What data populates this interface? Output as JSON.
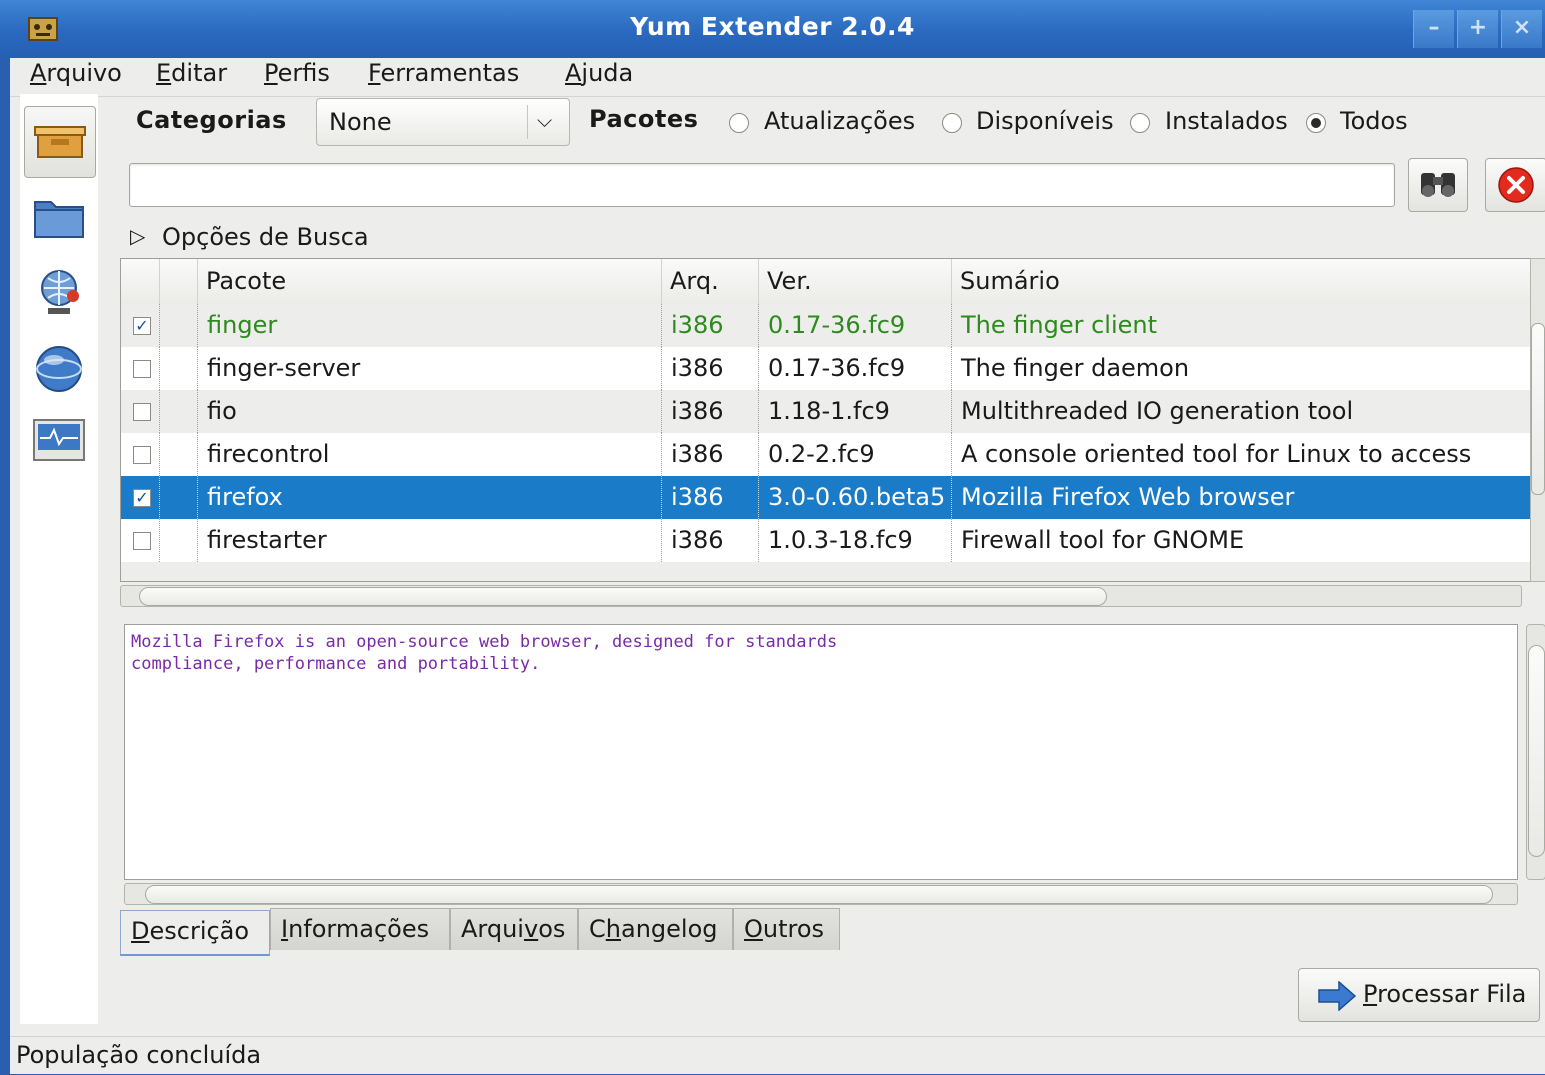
{
  "window": {
    "title": "Yum Extender 2.0.4"
  },
  "menu": [
    "Arquivo",
    "Editar",
    "Perfis",
    "Ferramentas",
    "Ajuda"
  ],
  "categories": {
    "label": "Categorias",
    "selected": "None"
  },
  "packages_filter": {
    "label": "Pacotes",
    "options": [
      "Atualizações",
      "Disponíveis",
      "Instalados",
      "Todos"
    ],
    "selected": "Todos"
  },
  "search": {
    "value": "",
    "options_label": "Opções de Busca"
  },
  "table": {
    "columns": [
      "Pacote",
      "Arq.",
      "Ver.",
      "Sumário"
    ],
    "rows": [
      {
        "checked": true,
        "name": "finger",
        "arch": "i386",
        "ver": "0.17-36.fc9",
        "summary": "The finger client"
      },
      {
        "checked": false,
        "name": "finger-server",
        "arch": "i386",
        "ver": "0.17-36.fc9",
        "summary": "The finger daemon"
      },
      {
        "checked": false,
        "name": "fio",
        "arch": "i386",
        "ver": "1.18-1.fc9",
        "summary": "Multithreaded IO generation tool"
      },
      {
        "checked": false,
        "name": "firecontrol",
        "arch": "i386",
        "ver": "0.2-2.fc9",
        "summary": "A console oriented tool for Linux to access"
      },
      {
        "checked": true,
        "name": "firefox",
        "arch": "i386",
        "ver": "3.0-0.60.beta5",
        "summary": "Mozilla Firefox Web browser"
      },
      {
        "checked": false,
        "name": "firestarter",
        "arch": "i386",
        "ver": "1.0.3-18.fc9",
        "summary": "Firewall tool for GNOME"
      }
    ]
  },
  "description": "Mozilla Firefox is an open-source web browser, designed for standards\ncompliance, performance and portability.",
  "tabs": [
    "Descrição",
    "Informações",
    "Arquivos",
    "Changelog",
    "Outros"
  ],
  "process_button": "Processar Fila",
  "status": "População concluída",
  "colors": {
    "titlebar": "#2a69bf",
    "selection": "#1a7bc8",
    "installed": "#2e8a1e",
    "description": "#7a29a8"
  }
}
